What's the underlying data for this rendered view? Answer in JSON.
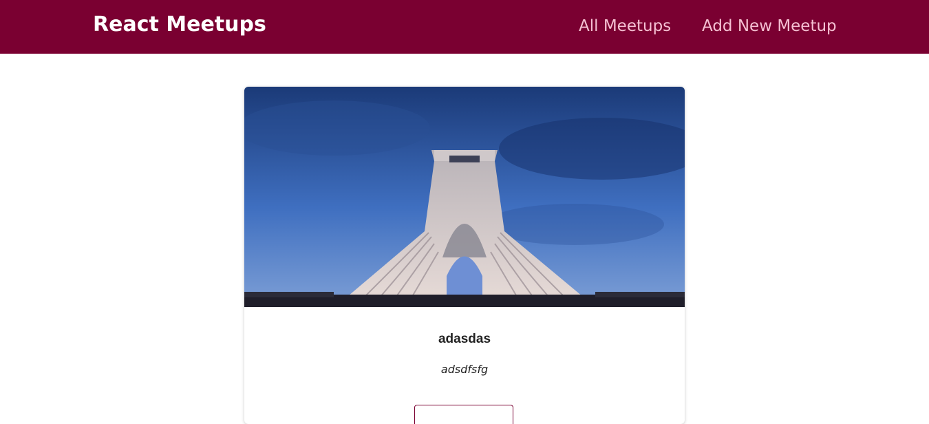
{
  "header": {
    "logo": "React Meetups",
    "nav": {
      "all_meetups": "All Meetups",
      "add_new_meetup": "Add New Meetup"
    }
  },
  "meetup": {
    "image_icon": "azadi-tower-photo",
    "title": "adasdas",
    "description": "adsdfsfg",
    "button_label": ""
  },
  "colors": {
    "header_bg": "#7a0031",
    "nav_link": "#f5c0d3",
    "accent": "#7a0031"
  }
}
